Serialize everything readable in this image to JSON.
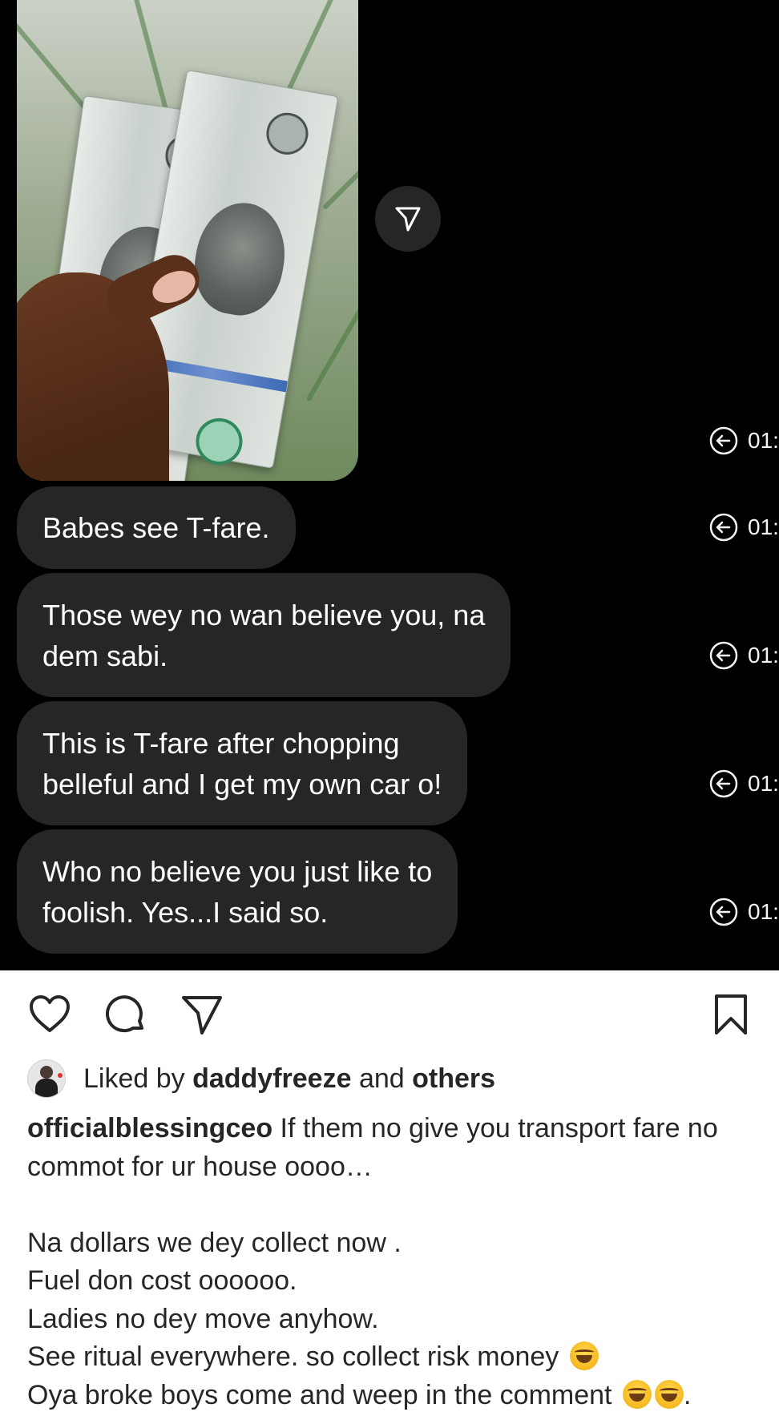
{
  "messages": [
    {
      "text_lines": [
        "Babes see T-fare."
      ],
      "time": "01:"
    },
    {
      "text_lines": [
        "Those wey no wan believe you, na",
        "dem sabi."
      ],
      "time": "01:"
    },
    {
      "text_lines": [
        "This is T-fare after chopping",
        "belleful and I get my own car o!"
      ],
      "time": "01:"
    },
    {
      "text_lines": [
        "Who no believe you just like to",
        "foolish. Yes...I said so."
      ],
      "time": "01:"
    }
  ],
  "photo_message": {
    "time": "01:",
    "alt": "hand holding two 100 dollar bills"
  },
  "actions": {
    "like_icon": "heart-icon",
    "comment_icon": "comment-icon",
    "share_icon": "send-icon",
    "save_icon": "bookmark-icon"
  },
  "likes": {
    "prefix": "Liked by",
    "user": "daddyfreeze",
    "middle": "and",
    "others": "others"
  },
  "caption": {
    "username": "officialblessingceo",
    "first_line_text": "If them no give you transport fare no",
    "lines": [
      "commot for ur house oooo…",
      "",
      "Na dollars we dey collect now .",
      "Fuel don cost oooooo.",
      "Ladies no dey move anyhow.",
      "See ritual everywhere. so collect risk money",
      "Oya broke boys come and weep in the comment"
    ],
    "emoji_name": "grinning-squint-face-emoji"
  },
  "colors": {
    "dm_background": "#000000",
    "bubble": "#262626",
    "text_dark": "#262626",
    "text_light": "#ffffff"
  }
}
